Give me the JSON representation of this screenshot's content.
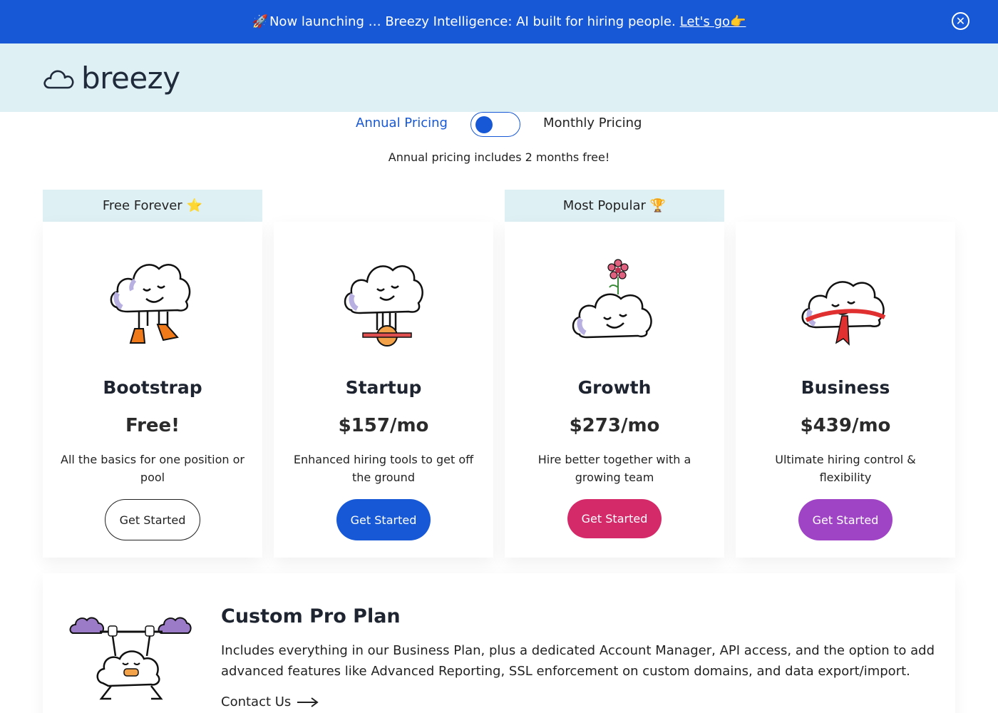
{
  "announcement": {
    "rocket": "🚀",
    "text": "Now launching … Breezy Intelligence: AI built for hiring people.",
    "link": "Let's go👉",
    "close_icon": "close-icon"
  },
  "header": {
    "logo_text": "breezy",
    "logo_icon": "cloud-icon"
  },
  "pricing_toggle": {
    "annual_label": "Annual Pricing",
    "monthly_label": "Monthly Pricing",
    "selected": "Annual Pricing",
    "note": "Annual pricing includes 2 months free!"
  },
  "badges": {
    "free": {
      "label": "Free Forever",
      "emoji": "⭐"
    },
    "popular": {
      "label": "Most Popular",
      "emoji": "🏆"
    }
  },
  "plans": [
    {
      "name": "Bootstrap",
      "price": "Free!",
      "description": "All the basics for one position or pool",
      "button": "Get Started",
      "button_color": "#ffffff",
      "illustration": "cloud-with-boots-icon"
    },
    {
      "name": "Startup",
      "price": "$157/mo",
      "description": "Enhanced hiring tools to get off the ground",
      "button": "Get Started",
      "button_color": "#1758d6",
      "illustration": "cloud-on-unicycle-icon"
    },
    {
      "name": "Growth",
      "price": "$273/mo",
      "description": "Hire better together with a growing team",
      "button": "Get Started",
      "button_color": "#d42a6a",
      "illustration": "cloud-with-flower-icon"
    },
    {
      "name": "Business",
      "price": "$439/mo",
      "description": "Ultimate hiring control & flexibility",
      "button": "Get Started",
      "button_color": "#a044c6",
      "illustration": "cloud-with-scarf-icon"
    }
  ],
  "custom_pro": {
    "title": "Custom Pro Plan",
    "description": "Includes everything in our Business Plan, plus a dedicated Account Manager, API access, and the option to add advanced features like Advanced Reporting, SSL enforcement on custom domains, and data export/import.",
    "contact": "Contact Us",
    "illustration": "cloud-lifting-weights-icon"
  },
  "colors": {
    "brand_blue": "#1758d6",
    "header_bg": "#dff0f5",
    "growth_pink": "#d42a6a",
    "business_purple": "#a044c6"
  }
}
